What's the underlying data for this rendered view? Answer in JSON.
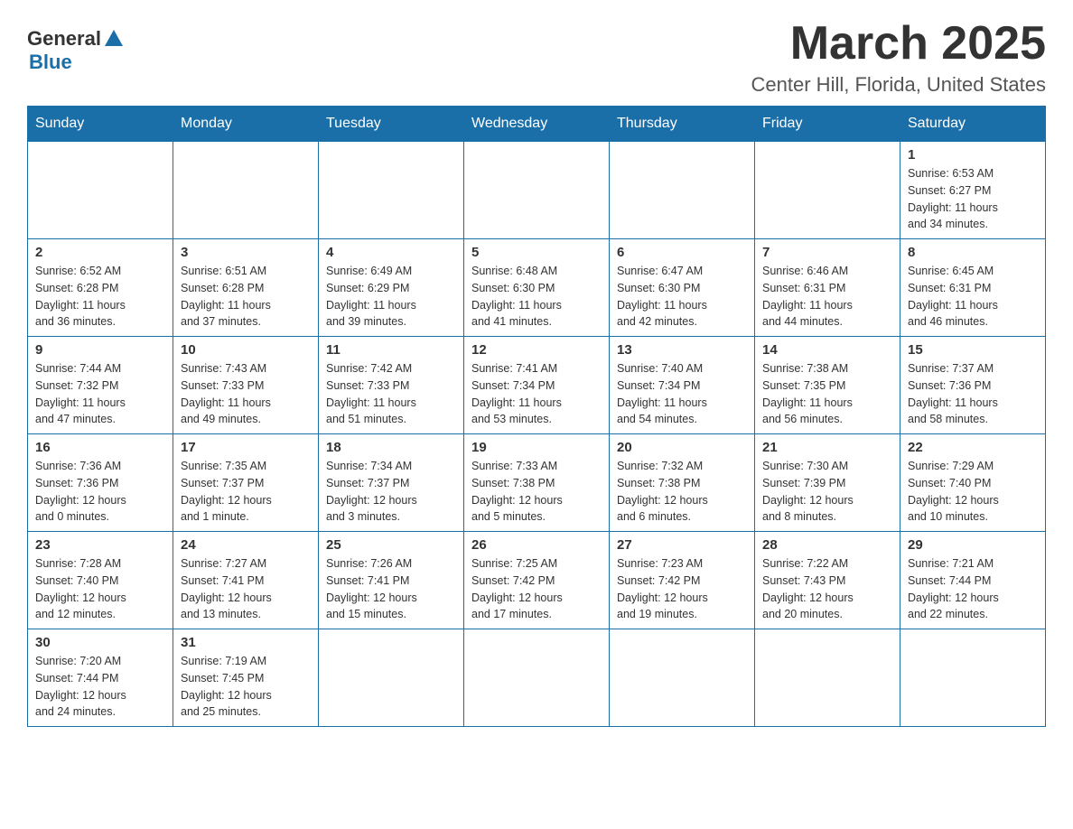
{
  "header": {
    "logo": {
      "general": "General",
      "triangle_color": "#1a6fa8",
      "blue": "Blue"
    },
    "title": "March 2025",
    "location": "Center Hill, Florida, United States"
  },
  "weekdays": [
    "Sunday",
    "Monday",
    "Tuesday",
    "Wednesday",
    "Thursday",
    "Friday",
    "Saturday"
  ],
  "weeks": [
    [
      {
        "day": "",
        "info": ""
      },
      {
        "day": "",
        "info": ""
      },
      {
        "day": "",
        "info": ""
      },
      {
        "day": "",
        "info": ""
      },
      {
        "day": "",
        "info": ""
      },
      {
        "day": "",
        "info": ""
      },
      {
        "day": "1",
        "info": "Sunrise: 6:53 AM\nSunset: 6:27 PM\nDaylight: 11 hours\nand 34 minutes."
      }
    ],
    [
      {
        "day": "2",
        "info": "Sunrise: 6:52 AM\nSunset: 6:28 PM\nDaylight: 11 hours\nand 36 minutes."
      },
      {
        "day": "3",
        "info": "Sunrise: 6:51 AM\nSunset: 6:28 PM\nDaylight: 11 hours\nand 37 minutes."
      },
      {
        "day": "4",
        "info": "Sunrise: 6:49 AM\nSunset: 6:29 PM\nDaylight: 11 hours\nand 39 minutes."
      },
      {
        "day": "5",
        "info": "Sunrise: 6:48 AM\nSunset: 6:30 PM\nDaylight: 11 hours\nand 41 minutes."
      },
      {
        "day": "6",
        "info": "Sunrise: 6:47 AM\nSunset: 6:30 PM\nDaylight: 11 hours\nand 42 minutes."
      },
      {
        "day": "7",
        "info": "Sunrise: 6:46 AM\nSunset: 6:31 PM\nDaylight: 11 hours\nand 44 minutes."
      },
      {
        "day": "8",
        "info": "Sunrise: 6:45 AM\nSunset: 6:31 PM\nDaylight: 11 hours\nand 46 minutes."
      }
    ],
    [
      {
        "day": "9",
        "info": "Sunrise: 7:44 AM\nSunset: 7:32 PM\nDaylight: 11 hours\nand 47 minutes."
      },
      {
        "day": "10",
        "info": "Sunrise: 7:43 AM\nSunset: 7:33 PM\nDaylight: 11 hours\nand 49 minutes."
      },
      {
        "day": "11",
        "info": "Sunrise: 7:42 AM\nSunset: 7:33 PM\nDaylight: 11 hours\nand 51 minutes."
      },
      {
        "day": "12",
        "info": "Sunrise: 7:41 AM\nSunset: 7:34 PM\nDaylight: 11 hours\nand 53 minutes."
      },
      {
        "day": "13",
        "info": "Sunrise: 7:40 AM\nSunset: 7:34 PM\nDaylight: 11 hours\nand 54 minutes."
      },
      {
        "day": "14",
        "info": "Sunrise: 7:38 AM\nSunset: 7:35 PM\nDaylight: 11 hours\nand 56 minutes."
      },
      {
        "day": "15",
        "info": "Sunrise: 7:37 AM\nSunset: 7:36 PM\nDaylight: 11 hours\nand 58 minutes."
      }
    ],
    [
      {
        "day": "16",
        "info": "Sunrise: 7:36 AM\nSunset: 7:36 PM\nDaylight: 12 hours\nand 0 minutes."
      },
      {
        "day": "17",
        "info": "Sunrise: 7:35 AM\nSunset: 7:37 PM\nDaylight: 12 hours\nand 1 minute."
      },
      {
        "day": "18",
        "info": "Sunrise: 7:34 AM\nSunset: 7:37 PM\nDaylight: 12 hours\nand 3 minutes."
      },
      {
        "day": "19",
        "info": "Sunrise: 7:33 AM\nSunset: 7:38 PM\nDaylight: 12 hours\nand 5 minutes."
      },
      {
        "day": "20",
        "info": "Sunrise: 7:32 AM\nSunset: 7:38 PM\nDaylight: 12 hours\nand 6 minutes."
      },
      {
        "day": "21",
        "info": "Sunrise: 7:30 AM\nSunset: 7:39 PM\nDaylight: 12 hours\nand 8 minutes."
      },
      {
        "day": "22",
        "info": "Sunrise: 7:29 AM\nSunset: 7:40 PM\nDaylight: 12 hours\nand 10 minutes."
      }
    ],
    [
      {
        "day": "23",
        "info": "Sunrise: 7:28 AM\nSunset: 7:40 PM\nDaylight: 12 hours\nand 12 minutes."
      },
      {
        "day": "24",
        "info": "Sunrise: 7:27 AM\nSunset: 7:41 PM\nDaylight: 12 hours\nand 13 minutes."
      },
      {
        "day": "25",
        "info": "Sunrise: 7:26 AM\nSunset: 7:41 PM\nDaylight: 12 hours\nand 15 minutes."
      },
      {
        "day": "26",
        "info": "Sunrise: 7:25 AM\nSunset: 7:42 PM\nDaylight: 12 hours\nand 17 minutes."
      },
      {
        "day": "27",
        "info": "Sunrise: 7:23 AM\nSunset: 7:42 PM\nDaylight: 12 hours\nand 19 minutes."
      },
      {
        "day": "28",
        "info": "Sunrise: 7:22 AM\nSunset: 7:43 PM\nDaylight: 12 hours\nand 20 minutes."
      },
      {
        "day": "29",
        "info": "Sunrise: 7:21 AM\nSunset: 7:44 PM\nDaylight: 12 hours\nand 22 minutes."
      }
    ],
    [
      {
        "day": "30",
        "info": "Sunrise: 7:20 AM\nSunset: 7:44 PM\nDaylight: 12 hours\nand 24 minutes."
      },
      {
        "day": "31",
        "info": "Sunrise: 7:19 AM\nSunset: 7:45 PM\nDaylight: 12 hours\nand 25 minutes."
      },
      {
        "day": "",
        "info": ""
      },
      {
        "day": "",
        "info": ""
      },
      {
        "day": "",
        "info": ""
      },
      {
        "day": "",
        "info": ""
      },
      {
        "day": "",
        "info": ""
      }
    ]
  ]
}
